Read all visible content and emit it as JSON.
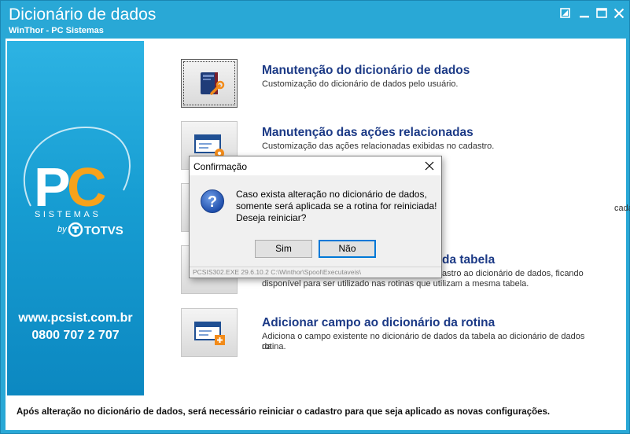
{
  "window": {
    "title": "Dicionário de dados",
    "subtitle": "WinThor - PC Sistemas",
    "controls": [
      "restore-icon",
      "minimize-icon",
      "maximize-icon",
      "close-icon"
    ]
  },
  "banner": {
    "logo_pc": "PC",
    "logo_sistemas": "SISTEMAS",
    "logo_by": "by",
    "logo_totvs": "TOTVS",
    "website": "www.pcsist.com.br",
    "phone": "0800 707 2 707"
  },
  "items": [
    {
      "title": "Manutenção do dicionário de dados",
      "desc": "Customização do dicionário de dados pelo usuário.",
      "icon": "dictionary-wrench-icon"
    },
    {
      "title": "Manutenção das ações relacionadas",
      "desc": "Customização das ações relacionadas exibidas no cadastro.",
      "icon": "window-gear-icon"
    },
    {
      "title": "",
      "desc": "cadastro.",
      "icon": "window-icon"
    },
    {
      "title": "da tabela",
      "desc_line1": "astro ao dicionário de dados, ficando",
      "desc_line2": "disponível para ser utilizado nas rotinas que utilizam a mesma tabela.",
      "icon": "window-icon"
    },
    {
      "title": "Adicionar campo ao dicionário da rotina",
      "desc_line1": "Adiciona o campo existente no dicionário de dados da tabela ao dicionário de dados da",
      "desc_line2": "rotina.",
      "icon": "window-add-icon"
    }
  ],
  "footer": {
    "note": "Após alteração no dicionário de dados, será necessário reiniciar o cadastro para que seja aplicado as novas configurações."
  },
  "dialog": {
    "title": "Confirmação",
    "message_lines": [
      "Caso exista alteração no dicionário de dados,",
      "somente será aplicada se a rotina for reiniciada!",
      "Deseja reiniciar?"
    ],
    "yes_label": "Sim",
    "no_label": "Não",
    "status": "PCSIS302.EXE 29.6.10.2 C:\\Winthor\\Spool\\Executaveis\\"
  },
  "colors": {
    "titlebar": "#29a8d6",
    "banner_top": "#2db3e3",
    "banner_bottom": "#0c88c1",
    "item_title": "#1c3a86",
    "logo_orange": "#f7a21b"
  }
}
